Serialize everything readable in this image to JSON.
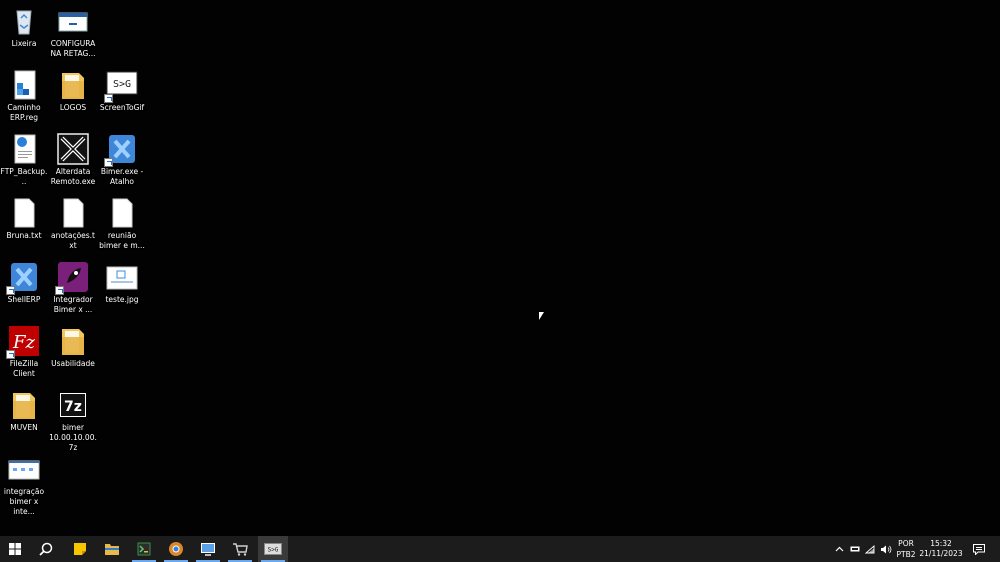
{
  "desktop": {
    "icons": [
      {
        "id": "lixeira",
        "label": "Lixeira",
        "icon": "recycle-bin-icon"
      },
      {
        "id": "configura",
        "label": "CONFIGURA NA RETAG...",
        "icon": "config-window-icon"
      },
      {
        "id": "caminho",
        "label": "Caminho ERP.reg",
        "icon": "registry-file-icon"
      },
      {
        "id": "logos",
        "label": "LOGOS",
        "icon": "folder-icon"
      },
      {
        "id": "screentogif",
        "label": "ScreenToGif",
        "icon": "screentogif-icon"
      },
      {
        "id": "ftp",
        "label": "FTP_Backup...",
        "icon": "web-file-icon"
      },
      {
        "id": "alterdata",
        "label": "Alterdata Remoto.exe",
        "icon": "alterdata-icon"
      },
      {
        "id": "bimer",
        "label": "Bimer.exe - Atalho",
        "icon": "bimer-icon"
      },
      {
        "id": "bruna",
        "label": "Bruna.txt",
        "icon": "text-file-icon"
      },
      {
        "id": "anotacoes",
        "label": "anotações.txt",
        "icon": "text-file-icon"
      },
      {
        "id": "reuniao",
        "label": "reunião bimer e m...",
        "icon": "text-file-icon"
      },
      {
        "id": "shellerp",
        "label": "ShellERP",
        "icon": "shellerp-icon"
      },
      {
        "id": "integrador",
        "label": "Integrador Bimer x ...",
        "icon": "rocket-icon"
      },
      {
        "id": "teste",
        "label": "teste.jpg",
        "icon": "image-file-icon"
      },
      {
        "id": "filezilla",
        "label": "FileZilla Client",
        "icon": "filezilla-icon"
      },
      {
        "id": "usabilidade",
        "label": "Usabilidade",
        "icon": "folder-icon"
      },
      {
        "id": "muven",
        "label": "MUVEN",
        "icon": "folder-icon"
      },
      {
        "id": "bimer7z",
        "label": "bimer 10.00.10.00.7z",
        "icon": "7zip-icon"
      },
      {
        "id": "integracao",
        "label": "integração bimer x inte...",
        "icon": "image-file-icon"
      }
    ]
  },
  "taskbar": {
    "start_icon": "windows-icon",
    "search_icon": "search-icon",
    "apps": [
      {
        "name": "sticky-notes-icon",
        "color": "#f7c600"
      },
      {
        "name": "file-explorer-icon",
        "color": "#e8b84a"
      },
      {
        "name": "terminal-app-icon",
        "color": "#3a8f4a"
      },
      {
        "name": "chrome-icon",
        "color": "#d9882a"
      },
      {
        "name": "remote-app-icon",
        "color": "#5aa0e8"
      },
      {
        "name": "store-cart-icon",
        "color": "#cfcfcf"
      },
      {
        "name": "screentogif-icon",
        "color": "#cfcfcf"
      }
    ],
    "tray": {
      "lang_top": "POR",
      "lang_bottom": "PTB2",
      "time": "15:32",
      "date": "21/11/2023"
    }
  },
  "colors": {
    "desktop_bg": "#020202",
    "taskbar_bg": "#1c1c1c",
    "active_indicator": "#6aa9f0"
  }
}
